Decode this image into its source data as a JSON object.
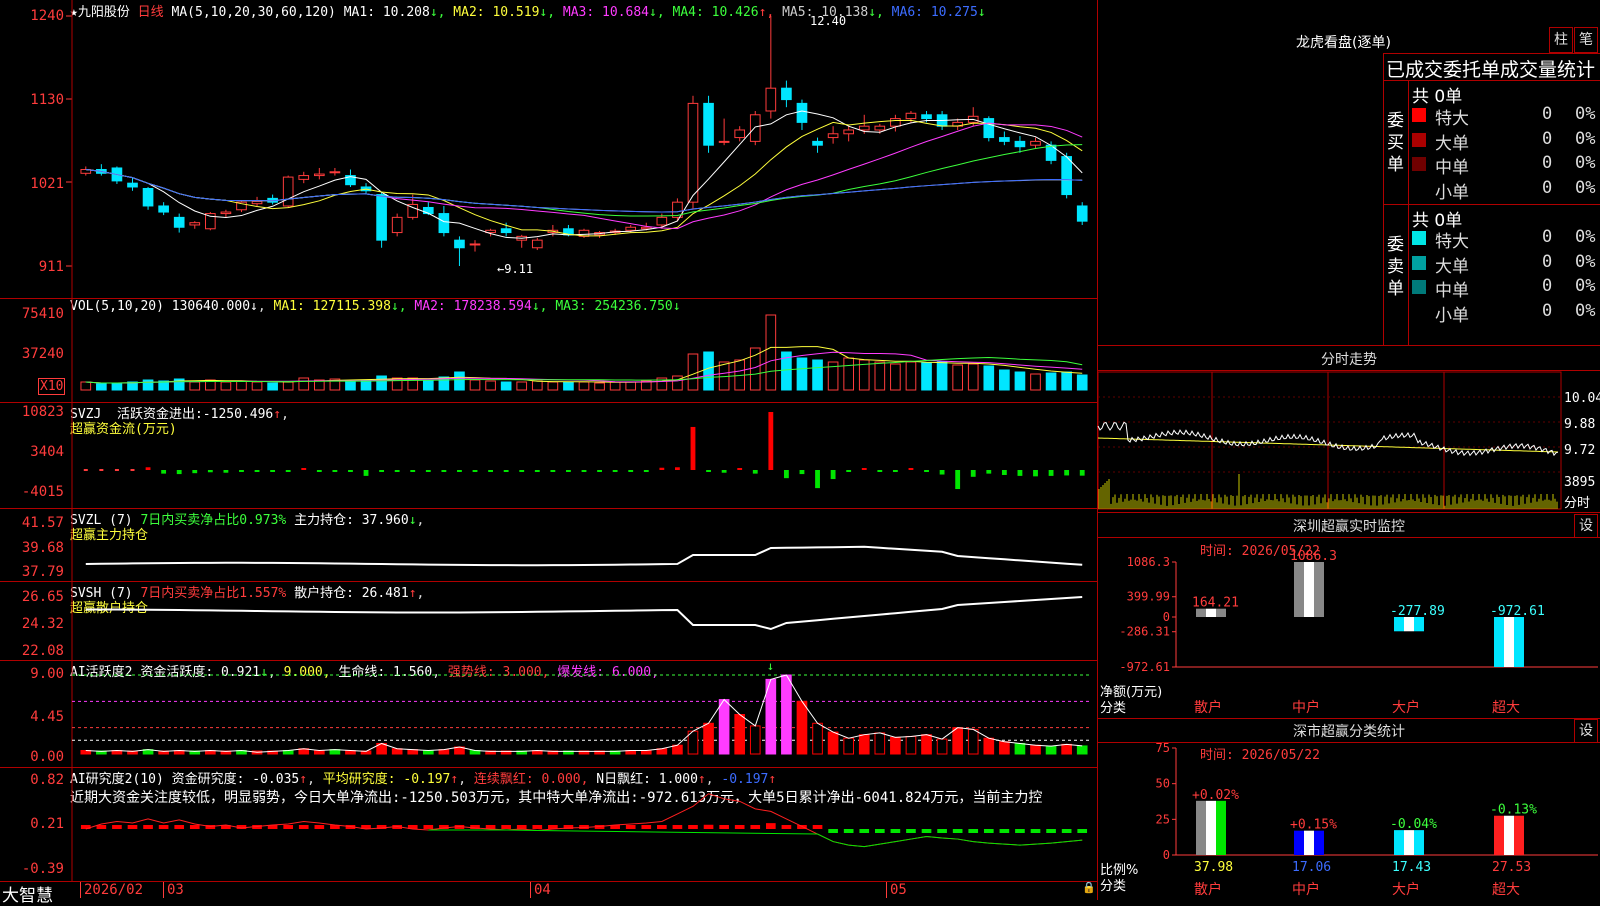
{
  "stock": {
    "name": "九阳股份",
    "period": "日线",
    "watermark": "大智慧"
  },
  "kline": {
    "ma_label": "MA(5,10,20,30,60,120)",
    "ma": [
      {
        "name": "MA1:",
        "value": "10.208",
        "arrow": "↓",
        "color": "#ffffff"
      },
      {
        "name": "MA2:",
        "value": "10.519",
        "arrow": "↓",
        "color": "#ffff3c"
      },
      {
        "name": "MA3:",
        "value": "10.684",
        "arrow": "↓",
        "color": "#ff3cff"
      },
      {
        "name": "MA4:",
        "value": "10.426",
        "arrow": "↑",
        "color": "#3cff3c"
      },
      {
        "name": "MA5:",
        "value": "10.138",
        "arrow": "↓",
        "color": "#cccccc"
      },
      {
        "name": "MA6:",
        "value": "10.275",
        "arrow": "↓",
        "color": "#3c6cff"
      }
    ],
    "yticks": [
      "1240",
      "1130",
      "1021",
      "911"
    ],
    "high_label": "12.40",
    "low_label": "←9.11",
    "candles": [
      [
        10.33,
        10.42,
        10.3,
        10.38
      ],
      [
        10.38,
        10.45,
        10.3,
        10.33
      ],
      [
        10.4,
        10.42,
        10.19,
        10.23
      ],
      [
        10.2,
        10.28,
        10.1,
        10.15
      ],
      [
        10.13,
        10.15,
        9.85,
        9.9
      ],
      [
        9.9,
        9.95,
        9.78,
        9.82
      ],
      [
        9.75,
        9.8,
        9.55,
        9.62
      ],
      [
        9.65,
        9.7,
        9.6,
        9.68
      ],
      [
        9.6,
        9.82,
        9.58,
        9.8
      ],
      [
        9.8,
        9.85,
        9.75,
        9.82
      ],
      [
        9.85,
        9.97,
        9.82,
        9.95
      ],
      [
        9.93,
        10.02,
        9.9,
        9.96
      ],
      [
        10.0,
        10.05,
        9.92,
        9.95
      ],
      [
        9.9,
        10.3,
        9.88,
        10.28
      ],
      [
        10.25,
        10.35,
        10.2,
        10.3
      ],
      [
        10.3,
        10.4,
        10.25,
        10.32
      ],
      [
        10.35,
        10.4,
        10.3,
        10.35
      ],
      [
        10.3,
        10.38,
        10.15,
        10.18
      ],
      [
        10.15,
        10.2,
        10.05,
        10.1
      ],
      [
        10.05,
        10.08,
        9.35,
        9.45
      ],
      [
        9.55,
        9.8,
        9.5,
        9.75
      ],
      [
        9.75,
        10.05,
        9.72,
        9.92
      ],
      [
        9.88,
        9.95,
        9.78,
        9.8
      ],
      [
        9.8,
        9.9,
        9.5,
        9.55
      ],
      [
        9.45,
        9.5,
        9.11,
        9.35
      ],
      [
        9.4,
        9.45,
        9.3,
        9.4
      ],
      [
        9.55,
        9.6,
        9.5,
        9.58
      ],
      [
        9.6,
        9.68,
        9.5,
        9.55
      ],
      [
        9.45,
        9.52,
        9.35,
        9.5
      ],
      [
        9.35,
        9.48,
        9.32,
        9.45
      ],
      [
        9.55,
        9.65,
        9.5,
        9.58
      ],
      [
        9.6,
        9.65,
        9.5,
        9.52
      ],
      [
        9.5,
        9.6,
        9.48,
        9.58
      ],
      [
        9.52,
        9.57,
        9.48,
        9.55
      ],
      [
        9.55,
        9.6,
        9.52,
        9.57
      ],
      [
        9.58,
        9.65,
        9.55,
        9.62
      ],
      [
        9.6,
        9.68,
        9.58,
        9.62
      ],
      [
        9.65,
        9.8,
        9.6,
        9.75
      ],
      [
        9.75,
        10.0,
        9.7,
        9.95
      ],
      [
        9.95,
        11.35,
        9.85,
        11.25
      ],
      [
        11.25,
        11.35,
        10.6,
        10.7
      ],
      [
        10.75,
        11.05,
        10.7,
        10.75
      ],
      [
        10.8,
        10.95,
        10.75,
        10.9
      ],
      [
        10.75,
        11.15,
        10.7,
        11.1
      ],
      [
        11.15,
        12.4,
        11.05,
        11.45
      ],
      [
        11.45,
        11.55,
        11.2,
        11.3
      ],
      [
        11.25,
        11.3,
        10.9,
        11.0
      ],
      [
        10.75,
        10.8,
        10.6,
        10.7
      ],
      [
        10.8,
        10.95,
        10.72,
        10.85
      ],
      [
        10.85,
        10.95,
        10.75,
        10.9
      ],
      [
        10.9,
        11.1,
        10.85,
        10.95
      ],
      [
        10.9,
        10.98,
        10.85,
        10.95
      ],
      [
        10.95,
        11.1,
        10.88,
        11.05
      ],
      [
        11.05,
        11.15,
        11.0,
        11.12
      ],
      [
        11.1,
        11.15,
        11.0,
        11.05
      ],
      [
        11.1,
        11.15,
        10.9,
        10.95
      ],
      [
        10.95,
        11.05,
        10.9,
        11.0
      ],
      [
        11.0,
        11.2,
        10.95,
        11.08
      ],
      [
        11.05,
        11.08,
        10.75,
        10.8
      ],
      [
        10.8,
        10.88,
        10.7,
        10.75
      ],
      [
        10.75,
        10.82,
        10.6,
        10.68
      ],
      [
        10.7,
        10.8,
        10.65,
        10.75
      ],
      [
        10.7,
        10.75,
        10.45,
        10.5
      ],
      [
        10.55,
        10.6,
        10.0,
        10.05
      ],
      [
        9.9,
        9.95,
        9.65,
        9.7
      ]
    ]
  },
  "volume": {
    "label": "VOL(5,10,20)",
    "value": "130640.000",
    "arrow": "↓",
    "ma": [
      {
        "name": "MA1:",
        "value": "127115.398",
        "arrow": "↓",
        "color": "#ffff3c"
      },
      {
        "name": "MA2:",
        "value": "178238.594",
        "arrow": "↓",
        "color": "#ff3cff"
      },
      {
        "name": "MA3:",
        "value": "254236.750",
        "arrow": "↓",
        "color": "#3cff3c"
      }
    ],
    "yticks": [
      "75410",
      "37240"
    ],
    "unit": "X10",
    "bars": [
      8,
      6,
      7,
      8,
      10,
      9,
      11,
      8,
      10,
      8,
      9,
      8,
      7,
      8,
      12,
      10,
      11,
      9,
      10,
      14,
      12,
      12,
      9,
      13,
      18,
      10,
      9,
      8,
      8,
      9,
      8,
      8,
      8,
      7,
      8,
      8,
      9,
      12,
      14,
      36,
      38,
      28,
      30,
      42,
      75,
      38,
      32,
      30,
      28,
      32,
      30,
      28,
      26,
      28,
      27,
      28,
      25,
      26,
      24,
      20,
      18,
      16,
      17,
      18,
      15
    ]
  },
  "svzj": {
    "label": "SVZJ",
    "item": "活跃资金进出:",
    "value": "-1250.496",
    "arrow": "↑",
    "sub": "超赢资金流(万元)",
    "yticks": [
      "10823",
      "3404",
      "-4015"
    ],
    "bars": [
      0,
      0,
      0,
      0,
      600,
      -800,
      -900,
      -700,
      -500,
      -600,
      -400,
      -300,
      -200,
      -300,
      300,
      -200,
      -300,
      -200,
      -1300,
      -200,
      -300,
      -100,
      -200,
      -300,
      -200,
      -300,
      -300,
      -200,
      -300,
      -200,
      -100,
      -200,
      -200,
      -100,
      -200,
      -200,
      -300,
      500,
      600,
      9500,
      -300,
      -600,
      400,
      -800,
      12800,
      -1800,
      -900,
      -4000,
      -2000,
      -200,
      400,
      -300,
      -200,
      300,
      -200,
      -1000,
      -4200,
      -1500,
      -800,
      -1100,
      -1300,
      -1400,
      -1300,
      -1200,
      -1250
    ]
  },
  "svzl": {
    "label": "SVZL (7)",
    "item": "7日内买卖净占比",
    "pct": "0.973%",
    "hold": "主力持仓:",
    "value": "37.960",
    "arrow": "↓",
    "sub": "超赢主力持仓",
    "yticks": [
      "41.57",
      "39.68",
      "37.79"
    ]
  },
  "svsh": {
    "label": "SVSH (7)",
    "item": "7日内买卖净占比",
    "pct": "1.557%",
    "hold": "散户持仓:",
    "value": "26.481",
    "arrow": "↑",
    "sub": "超赢散户持仓",
    "yticks": [
      "26.65",
      "24.32",
      "22.08"
    ]
  },
  "ai1": {
    "label": "AI活跃度2",
    "item": "资金活跃度:",
    "value": "0.921",
    "v2": "9.000",
    "v3label": "生命线:",
    "v3": "1.560",
    "v4label": "强势线:",
    "v4": "3.000",
    "v5label": "爆发线:",
    "v5": "6.000",
    "yticks": [
      "9.00",
      "4.45",
      "0.00"
    ]
  },
  "ai2": {
    "label": "AI研究度2(10)",
    "item": "资金研究度:",
    "value": "-0.035",
    "avg_label": "平均研究度:",
    "avg": "-0.197",
    "lx_label": "连续飘红:",
    "lx": "0.000",
    "n_label": "N日飘红:",
    "n": "1.000",
    "last": "-0.197",
    "comment": "近期大资金关注度较低，明显弱势，今日大单净流出:-1250.503万元，其中特大单净流出:-972.613万元，大单5日累计净出-6041.824万元，当前主力控",
    "yticks": [
      "0.82",
      "0.21",
      "-0.39"
    ]
  },
  "dates": [
    "2026/02",
    "03",
    "04",
    "05"
  ],
  "right": {
    "lhb_title": "龙虎看盘(逐单)",
    "btn_zhu": "柱",
    "btn_bi": "笔",
    "stat_title": "已成交委托单成交量统计",
    "buy_side": "委买单",
    "sell_side": "委卖单",
    "buy_total": "共 0单",
    "sell_total": "共 0单",
    "buy_rows": [
      {
        "name": "特大",
        "n": "0",
        "p": "0%",
        "c": "#ff0000"
      },
      {
        "name": "大单",
        "n": "0",
        "p": "0%",
        "c": "#aa0000"
      },
      {
        "name": "中单",
        "n": "0",
        "p": "0%",
        "c": "#700000"
      },
      {
        "name": "小单",
        "n": "0",
        "p": "0%",
        "c": ""
      }
    ],
    "sell_rows": [
      {
        "name": "特大",
        "n": "0",
        "p": "0%",
        "c": "#00e6e6"
      },
      {
        "name": "大单",
        "n": "0",
        "p": "0%",
        "c": "#00a0a0"
      },
      {
        "name": "中单",
        "n": "0",
        "p": "0%",
        "c": "#007a7a"
      },
      {
        "name": "小单",
        "n": "0",
        "p": "0%",
        "c": ""
      }
    ],
    "fs_title": "分时走势",
    "fs_yticks": [
      "10.04",
      "9.88",
      "9.72"
    ],
    "fs_vol": "3895",
    "fs_unit": "分时",
    "sz_title": "深圳超赢实时监控",
    "sz_btn": "设",
    "sz_time": "时间: 2026/05/22",
    "sz_yticks": [
      "1086.3",
      "399.99",
      "0",
      "-286.31",
      "-972.61"
    ],
    "sz_unit": "净额(万元)",
    "sz_cat": "分类",
    "sz_bars": [
      {
        "cat": "散户",
        "v": 164.21,
        "label": "164.21",
        "lc": "#ff3c3c",
        "cc": "#ff3c3c"
      },
      {
        "cat": "中户",
        "v": 1086.3,
        "label": "1086.3",
        "lc": "#ff3c3c",
        "cc": "#ff3c3c"
      },
      {
        "cat": "大户",
        "v": -277.89,
        "label": "-277.89",
        "lc": "#3cffff",
        "cc": "#ff3c3c"
      },
      {
        "cat": "超大",
        "v": -972.61,
        "label": "-972.61",
        "lc": "#3cffff",
        "cc": "#ff3c3c"
      }
    ],
    "ss_title": "深市超赢分类统计",
    "ss_btn": "设",
    "ss_time": "时间: 2026/05/22",
    "ss_yticks": [
      "75",
      "50",
      "25",
      "0"
    ],
    "ss_unit": "比例%",
    "ss_cat": "分类",
    "ss_bars": [
      {
        "cat": "散户",
        "v": 37.98,
        "pct": "+0.02%",
        "pc": "#ff3c3c",
        "val": "37.98",
        "vc": "#ffff3c",
        "kind": "white-green"
      },
      {
        "cat": "中户",
        "v": 17.06,
        "pct": "+0.15%",
        "pc": "#ff3c3c",
        "val": "17.06",
        "vc": "#3c6cff",
        "kind": "blue"
      },
      {
        "cat": "大户",
        "v": 17.43,
        "pct": "-0.04%",
        "pc": "#3cff3c",
        "val": "17.43",
        "vc": "#3cffff",
        "kind": "cyan"
      },
      {
        "cat": "超大",
        "v": 27.53,
        "pct": "-0.13%",
        "pc": "#3cff3c",
        "val": "27.53",
        "vc": "#ff3c3c",
        "kind": "red"
      }
    ]
  }
}
